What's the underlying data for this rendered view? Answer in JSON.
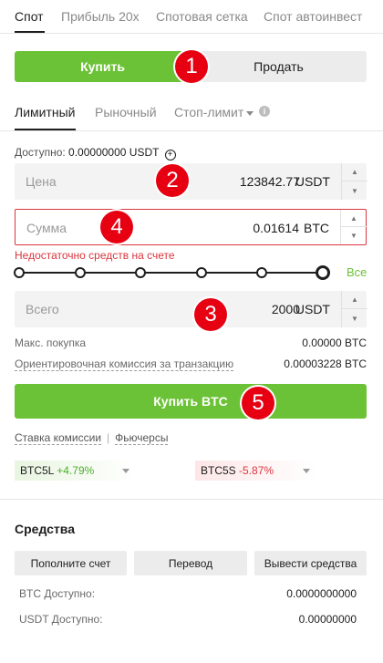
{
  "top_tabs": [
    "Спот",
    "Прибыль 20x",
    "Спотовая сетка",
    "Спот автоинвест"
  ],
  "side_toggle": {
    "buy": "Купить",
    "sell": "Продать"
  },
  "order_tabs": [
    "Лимитный",
    "Рыночный",
    "Стоп-лимит"
  ],
  "available": {
    "label": "Доступно:",
    "value": "0.00000000 USDT"
  },
  "price_field": {
    "label": "Цена",
    "value": "123842.77",
    "unit": "USDT"
  },
  "amount_field": {
    "label": "Сумма",
    "value": "0.01614",
    "unit": "BTC"
  },
  "error_message": "Недостаточно средств на счете",
  "slider": {
    "all_label": "Все",
    "level": 1.0
  },
  "total_field": {
    "label": "Всего",
    "value": "2000",
    "unit": "USDT"
  },
  "max_buy": {
    "label": "Макс. покупка",
    "value": "0.00000 BTC"
  },
  "fee": {
    "label": "Ориентировочная комиссия за транзакцию",
    "value": "0.00003228 BTC"
  },
  "submit_label": "Купить BTC",
  "links": {
    "fee_rate": "Ставка комиссии",
    "futures": "Фьючерсы"
  },
  "tickers": [
    {
      "pair": "BTC5L",
      "change": "+4.79%"
    },
    {
      "pair": "BTC5S",
      "change": "-5.87%"
    }
  ],
  "assets": {
    "title": "Средства",
    "buttons": [
      "Пополните счет",
      "Перевод",
      "Вывести средства"
    ],
    "btc_label": "BTC Доступно:",
    "btc_value": "0.0000000000",
    "usdt_label": "USDT Доступно:",
    "usdt_value": "0.00000000"
  },
  "annotations": [
    "1",
    "2",
    "3",
    "4",
    "5"
  ],
  "colors": {
    "accent_green": "#6cc236",
    "error_red": "#d9363e",
    "badge_red": "#e60012"
  }
}
